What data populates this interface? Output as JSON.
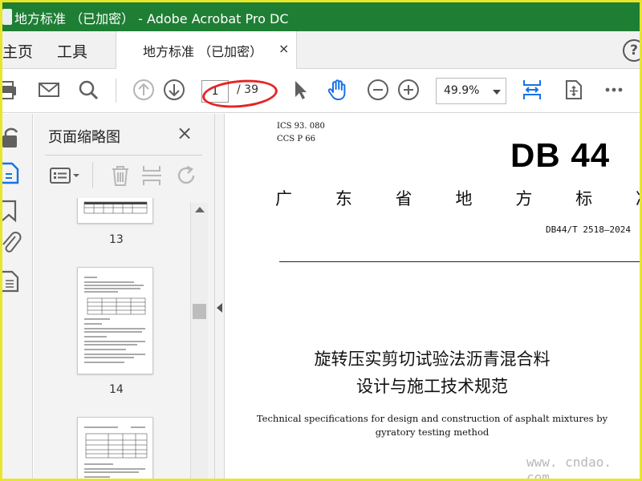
{
  "window": {
    "title": "地方标准 （已加密） - Adobe Acrobat Pro DC"
  },
  "nav": {
    "home": "主页",
    "tools": "工具",
    "help": "?"
  },
  "tab": {
    "label": "地方标准 （已加密）",
    "close": "×"
  },
  "toolbar": {
    "page_current": "1",
    "page_total": "/ 39",
    "zoom": "49.9%",
    "icons": [
      "print-icon",
      "mail-icon",
      "search-icon",
      "prev-page-icon",
      "next-page-icon",
      "select-cursor-icon",
      "hand-tool-icon",
      "zoom-out-icon",
      "zoom-in-icon",
      "fit-width-icon",
      "scroll-mode-icon",
      "more-icon"
    ]
  },
  "rail": {
    "icons": [
      "lock-icon",
      "pages-icon",
      "bookmark-icon",
      "attachment-icon",
      "document-icon"
    ]
  },
  "panel": {
    "title": "页面缩略图",
    "close": "×",
    "icons": [
      "options-icon",
      "delete-icon",
      "insert-icon",
      "rotate-icon"
    ],
    "thumbs": [
      {
        "page": "13"
      },
      {
        "page": "14"
      }
    ]
  },
  "document": {
    "ics": "ICS  93. 080",
    "ccs": "CCS  P  66",
    "db": "DB 44",
    "province": [
      "广",
      "东",
      "省",
      "地",
      "方",
      "标",
      "准"
    ],
    "std_no": "DB44/T  2518—2024",
    "title_line1": "旋转压实剪切试验法沥青混合料",
    "title_line2": "设计与施工技术规范",
    "en_line1": "Technical specifications for design and construction of asphalt mixtures by",
    "en_line2": "gyratory testing method"
  },
  "watermark": "www. cndao. com",
  "colors": {
    "titlebar": "#1e7e34",
    "active_blue": "#1473e6",
    "annotation_red": "#e52424",
    "frame_yellow": "#e8e62a"
  }
}
